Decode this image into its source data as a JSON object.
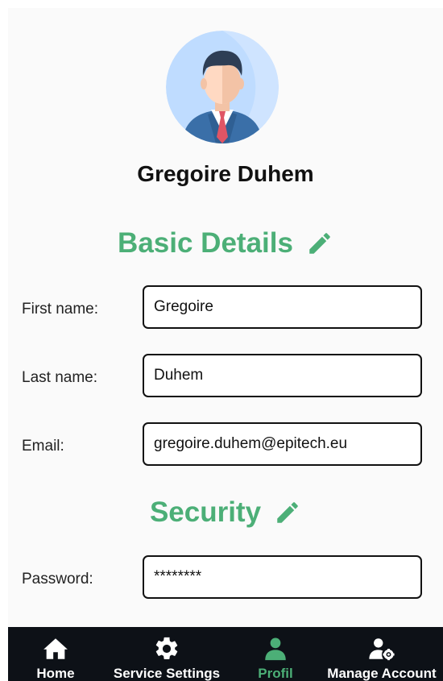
{
  "profile": {
    "name": "Gregoire Duhem"
  },
  "sections": {
    "basic_details": {
      "title": "Basic Details",
      "edit_icon": "pencil-icon"
    },
    "security": {
      "title": "Security",
      "edit_icon": "pencil-icon"
    }
  },
  "fields": {
    "first_name": {
      "label": "First name:",
      "value": "Gregoire"
    },
    "last_name": {
      "label": "Last name:",
      "value": "Duhem"
    },
    "email": {
      "label": "Email:",
      "value": "gregoire.duhem@epitech.eu"
    },
    "password": {
      "label": "Password:",
      "value": "********"
    }
  },
  "nav": {
    "items": [
      {
        "label": "Home",
        "icon": "home-icon"
      },
      {
        "label": "Service Settings",
        "icon": "gear-icon"
      },
      {
        "label": "Profil",
        "icon": "person-icon",
        "active": true
      },
      {
        "label": "Manage Account",
        "icon": "user-gear-icon"
      }
    ]
  },
  "colors": {
    "accent": "#4caf77",
    "nav_background": "#0d1117",
    "avatar_background": "#bfdcff"
  }
}
